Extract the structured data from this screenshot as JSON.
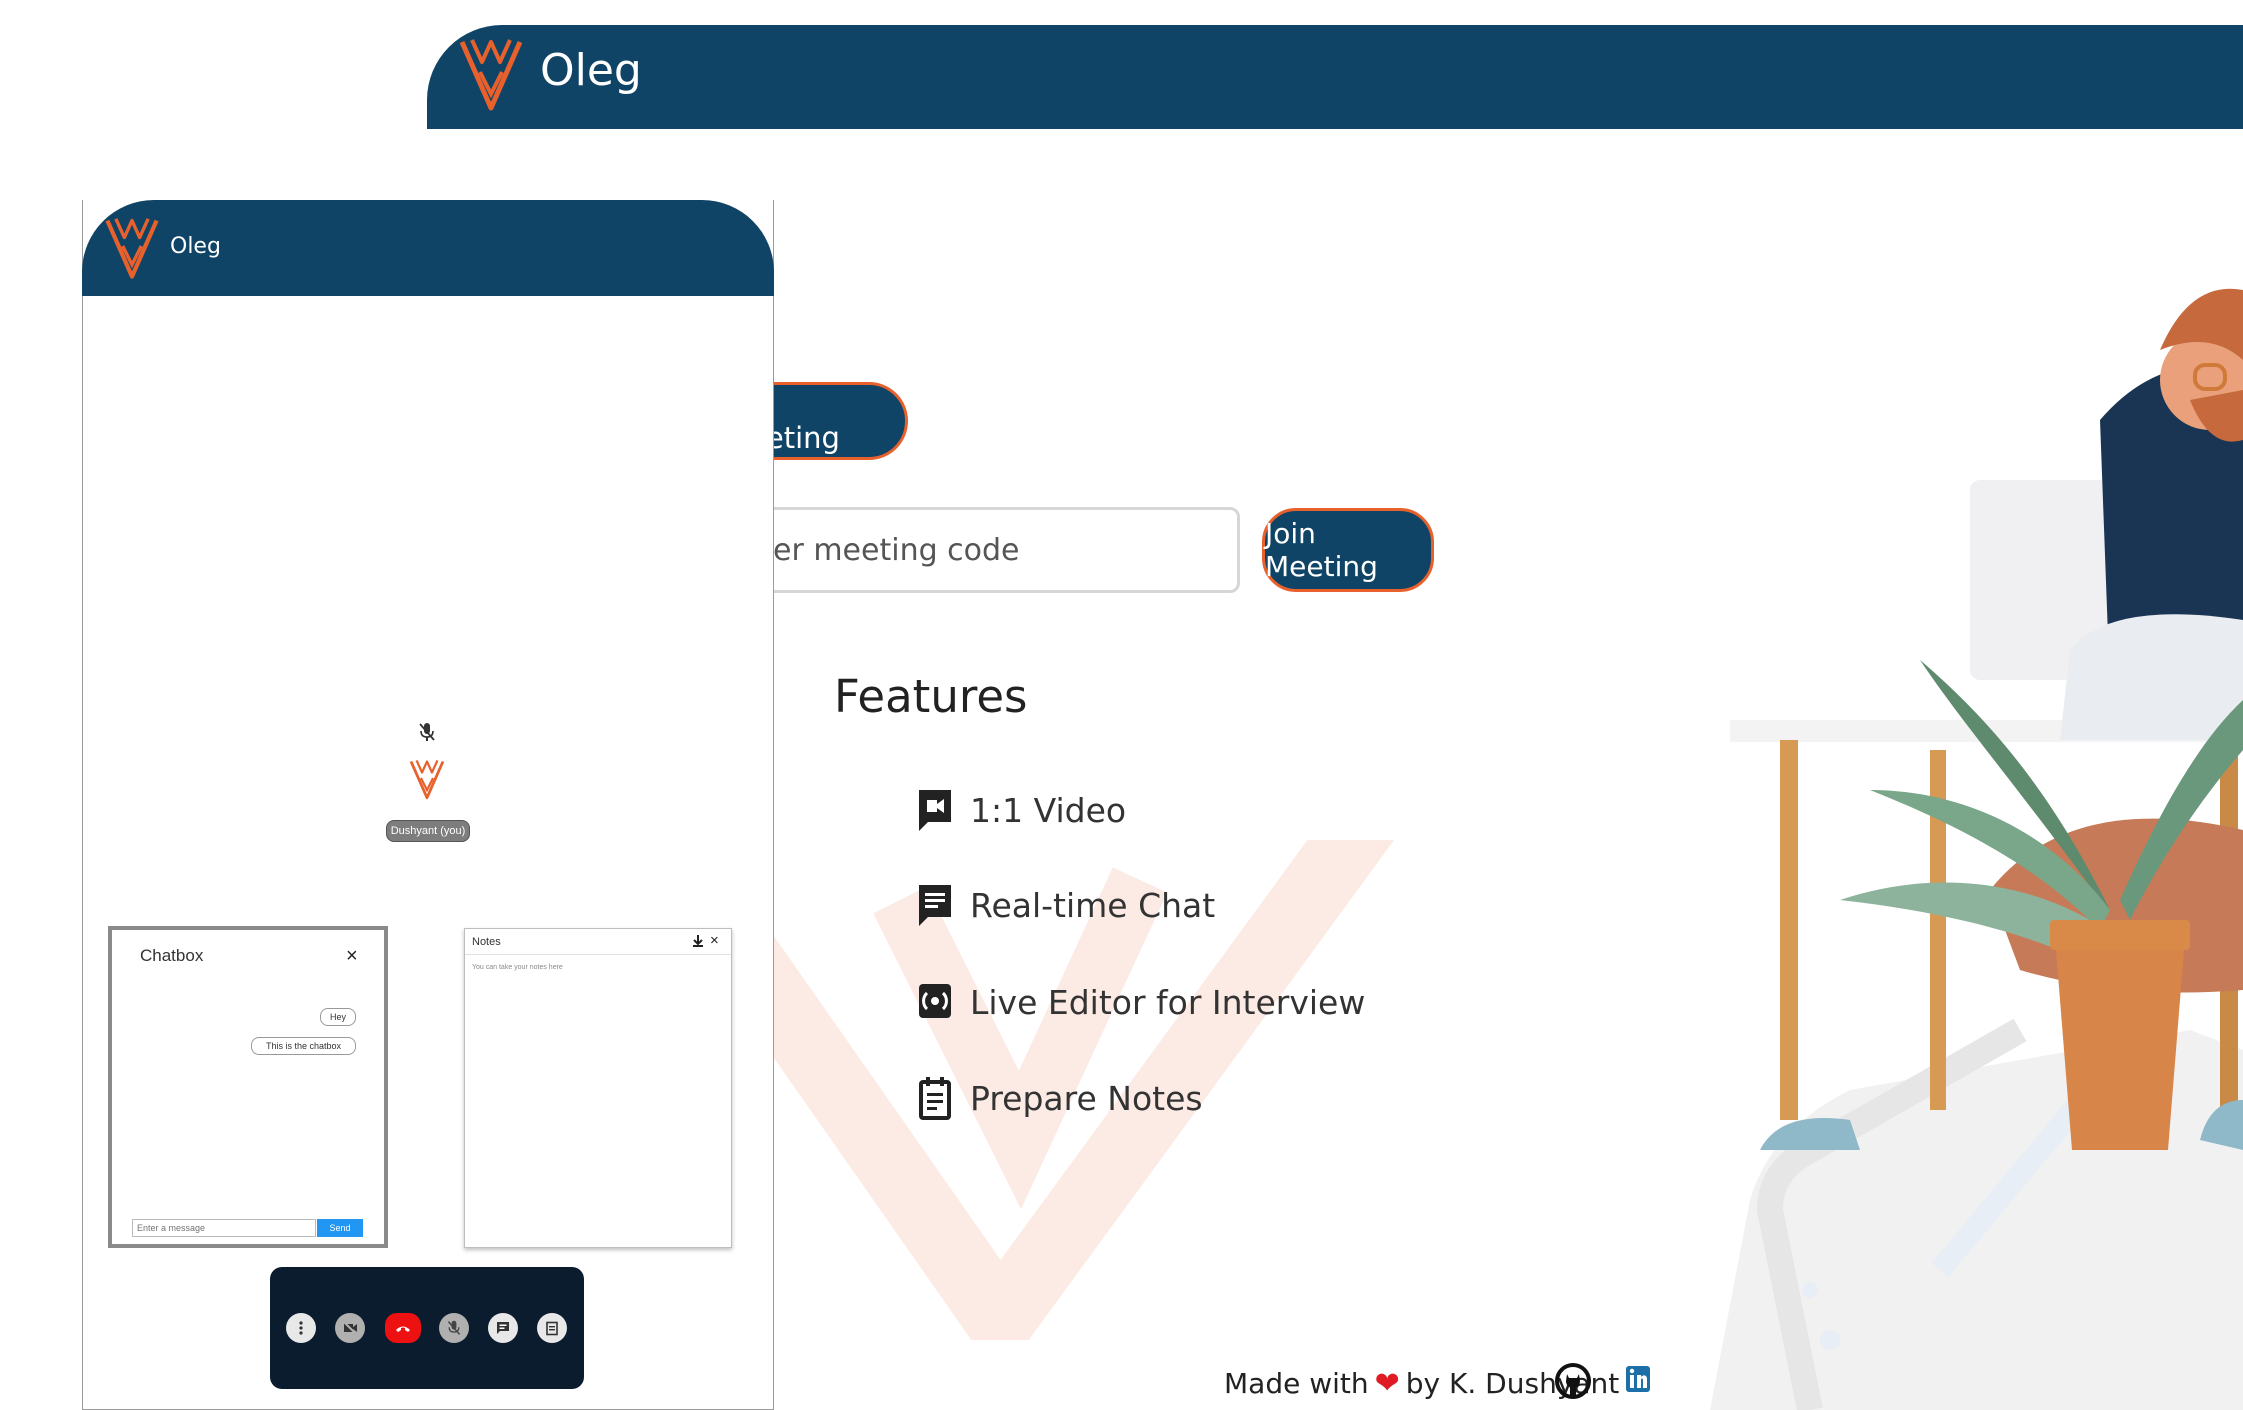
{
  "app": {
    "name": "Oleg"
  },
  "landing": {
    "start_meeting_label": "art Meeting",
    "meeting_code_placeholder": "er meeting code",
    "join_meeting_label": "Join Meeting",
    "features_title": "Features",
    "features": [
      {
        "label": "1:1 Video",
        "icon": "video-chat-icon"
      },
      {
        "label": "Real-time Chat",
        "icon": "chat-icon"
      },
      {
        "label": "Live Editor for Interview",
        "icon": "live-editor-icon"
      },
      {
        "label": "Prepare Notes",
        "icon": "notes-icon"
      }
    ],
    "footer": {
      "made_with": "Made with",
      "heart": "❤",
      "by": "by K. Dushyant",
      "github_icon": "github-icon",
      "linkedin_icon": "linkedin-icon"
    }
  },
  "call": {
    "participant_name": "Dushyant (you)",
    "chatbox": {
      "title": "Chatbox",
      "close": "×",
      "messages": [
        "Hey",
        "This is the chatbox"
      ],
      "input_placeholder": "Enter a message",
      "send_label": "Send"
    },
    "notes": {
      "title": "Notes",
      "close": "×",
      "placeholder": "You can take your notes here"
    },
    "controls": [
      "more-icon",
      "camera-off-icon",
      "end-call-icon",
      "mic-off-icon",
      "chat-icon",
      "notes-icon"
    ]
  },
  "colors": {
    "brand_navy": "#0f4466",
    "accent_orange": "#e8602c",
    "control_bar": "#0b1c2e",
    "end_call_red": "#ee1111",
    "send_blue": "#2196f3"
  }
}
